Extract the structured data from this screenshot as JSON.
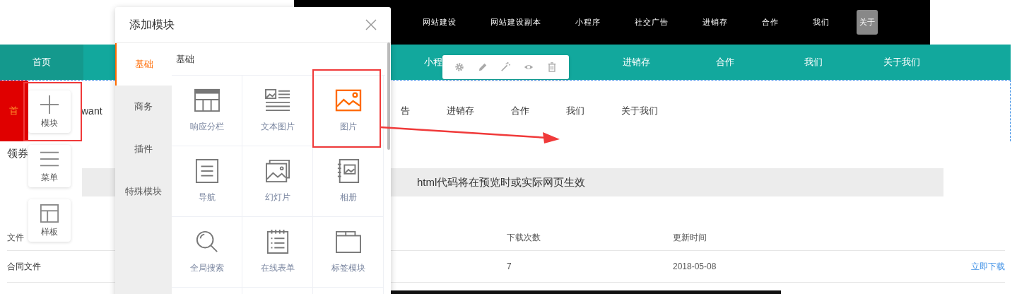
{
  "top_nav": {
    "items": [
      {
        "label": "网站建设"
      },
      {
        "label": "网站建设副本"
      },
      {
        "label": "小程序"
      },
      {
        "label": "社交广告"
      },
      {
        "label": "进销存"
      },
      {
        "label": "合作"
      },
      {
        "label": "我们"
      }
    ],
    "active_button": "关于"
  },
  "main_nav": {
    "items": [
      {
        "label": "首页",
        "selected": true
      },
      {
        "label": "小程",
        "selected": false
      },
      {
        "label": "进销存",
        "selected": false
      },
      {
        "label": "合作",
        "selected": false
      },
      {
        "label": "我们",
        "selected": false
      },
      {
        "label": "关于我们",
        "selected": false
      }
    ]
  },
  "sub_nav": {
    "home": "首",
    "brand": "want",
    "items": [
      "告",
      "进销存",
      "合作",
      "我们",
      "关于我们"
    ]
  },
  "coupon_title": "领券",
  "html_notice": "html代码将在预览时或实际网页生效",
  "table": {
    "columns": [
      "文件",
      "下载次数",
      "更新时间"
    ],
    "rows": [
      {
        "name": "合同文件",
        "downloads": "7",
        "updated": "2018-05-08",
        "action": "立即下载"
      }
    ]
  },
  "side_tools": [
    {
      "kind": "module",
      "label": "模块"
    },
    {
      "kind": "menu",
      "label": "菜单"
    },
    {
      "kind": "template",
      "label": "样板"
    }
  ],
  "dialog": {
    "title": "添加模块",
    "tabs": [
      {
        "label": "基础",
        "selected": true
      },
      {
        "label": "商务",
        "selected": false
      },
      {
        "label": "插件",
        "selected": false
      },
      {
        "label": "特殊模块",
        "selected": false
      }
    ],
    "section_title": "基础",
    "modules": [
      {
        "kind": "columns",
        "label": "响应分栏",
        "selected": false
      },
      {
        "kind": "text-image",
        "label": "文本图片",
        "selected": false
      },
      {
        "kind": "image",
        "label": "图片",
        "selected": true
      },
      {
        "kind": "nav",
        "label": "导航",
        "selected": false
      },
      {
        "kind": "slides",
        "label": "幻灯片",
        "selected": false
      },
      {
        "kind": "album",
        "label": "相册",
        "selected": false
      },
      {
        "kind": "search",
        "label": "全局搜索",
        "selected": false
      },
      {
        "kind": "form",
        "label": "在线表单",
        "selected": false
      },
      {
        "kind": "tabs",
        "label": "标签模块",
        "selected": false
      }
    ]
  }
}
